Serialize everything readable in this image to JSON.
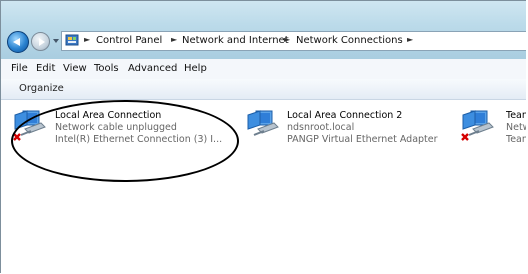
{
  "address": {
    "crumbs": [
      "Control Panel",
      "Network and Internet",
      "Network Connections"
    ],
    "icon": "control-panel-icon"
  },
  "menu": [
    "File",
    "Edit",
    "View",
    "Tools",
    "Advanced",
    "Help"
  ],
  "toolbar": {
    "organize_label": "Organize"
  },
  "connections": [
    {
      "name": "Local Area Connection",
      "status": "Network cable unplugged",
      "adapter": "Intel(R) Ethernet Connection (3) I...",
      "icon": "network-adapter-icon",
      "disconnected": true
    },
    {
      "name": "Local Area Connection 2",
      "status": "ndsnroot.local",
      "adapter": "PANGP Virtual Ethernet Adapter",
      "icon": "network-adapter-icon",
      "disconnected": false
    },
    {
      "name": "Team",
      "status": "Netw",
      "adapter": "Team",
      "icon": "network-adapter-icon",
      "disconnected": true
    }
  ]
}
